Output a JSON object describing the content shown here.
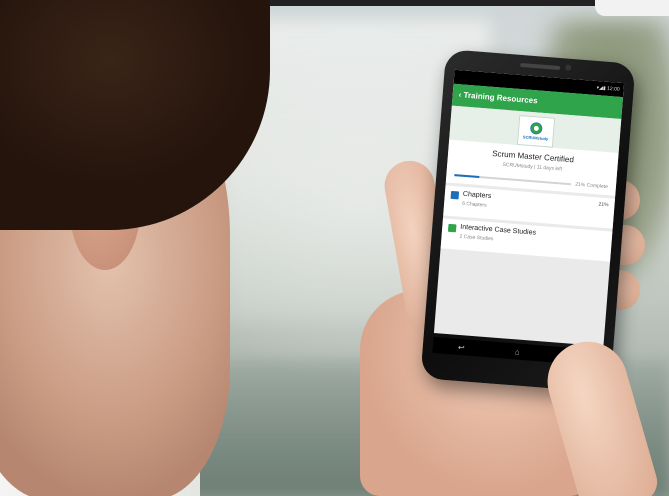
{
  "status_bar": {
    "time": "12:00"
  },
  "app_bar": {
    "back_icon": "chevron-left-icon",
    "title": "Training Resources",
    "color": "#2fa44a"
  },
  "logo": {
    "text": "SCRUMstudy"
  },
  "course": {
    "title": "Scrum Master Certified",
    "meta": "SCRUMstudy | 11 days left",
    "progress": 0.21,
    "progress_label": "21% Complete",
    "progress_color": "#1b6fb8"
  },
  "items": [
    {
      "title": "Chapters",
      "subtitle": "6 Chapters",
      "percent": "21%",
      "icon": "book-icon",
      "icon_color": "#1b6fb8"
    },
    {
      "title": "Interactive Case Studies",
      "subtitle": "2 Case Studies",
      "percent": "",
      "icon": "case-study-icon",
      "icon_color": "#2fa44a"
    }
  ],
  "nav": {
    "back": "↩",
    "home": "⌂",
    "recent": "▭"
  }
}
